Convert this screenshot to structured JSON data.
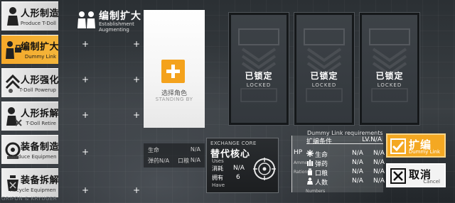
{
  "colors": {
    "accent": "#f4a822",
    "active_tab": "#f6a92a",
    "panel_light": "#ffffff",
    "locked_card": "#3a3f44"
  },
  "sidebar": {
    "items": [
      {
        "cn": "人形制造",
        "en": "Produce T-Doll",
        "icon": "doll-icon",
        "active": false
      },
      {
        "cn": "编制扩大",
        "en": "Dummy Link",
        "icon": "dummy-link-icon",
        "active": true
      },
      {
        "cn": "人形强化",
        "en": "T-Doll Powerup",
        "icon": "powerup-icon",
        "active": false
      },
      {
        "cn": "人形拆解",
        "en": "T-Doll Retire",
        "icon": "retire-icon",
        "active": false
      },
      {
        "cn": "装备制造",
        "en": "Produce Equipment",
        "icon": "equipment-produce-icon",
        "active": false
      },
      {
        "cn": "装备拆解",
        "en": "Recycle Equipment",
        "icon": "equipment-recycle-icon",
        "active": false
      }
    ],
    "footer": "GRIFON & KRYUGER"
  },
  "header": {
    "icon": "group-icon",
    "title_cn": "编制扩大",
    "title_en_1": "Establishment",
    "title_en_2": "Augmenting"
  },
  "select_slot": {
    "label_cn": "选择角色",
    "label_en": "STANDING BY",
    "icon": "plus-icon"
  },
  "locked_cards": [
    {
      "cn": "已锁定",
      "en": "LOCKED"
    },
    {
      "cn": "已锁定",
      "en": "LOCKED"
    },
    {
      "cn": "已锁定",
      "en": "LOCKED"
    }
  ],
  "stats": {
    "hp_label": "生命",
    "hp_value": "N/A",
    "ammo_label": "弹药N/A",
    "rations_label": "口粮",
    "rations_value": "N/A"
  },
  "exchange_core": {
    "title_en": "EXCHANGE CORE",
    "title_cn": "替代核心",
    "uses_en": "Uses",
    "uses_cn": "消耗",
    "uses_value": "N/A",
    "have_cn": "拥有",
    "have_value": "6",
    "have_en": "Have",
    "icon": "target-icon"
  },
  "requirements": {
    "title_en": "Dummy Link requirements",
    "header_cn": "扩编条件",
    "header_lv": "LV.N/A",
    "side_hp": "HP",
    "side_ammo": "Ammo",
    "side_rations": "Rations",
    "numbers_label": "Numbers",
    "rows": [
      {
        "icon": "hp-icon",
        "name": "生命",
        "v1": "N/A",
        "v2": "N/A"
      },
      {
        "icon": "ammo-icon",
        "name": "弹药",
        "v1": "N/A",
        "v2": "N/A"
      },
      {
        "icon": "rations-icon",
        "name": "口粮",
        "v1": "N/A",
        "v2": "N/A"
      },
      {
        "icon": "people-icon",
        "name": "人数",
        "v1": "N/A",
        "v2": "N/A"
      }
    ]
  },
  "actions": {
    "upgrade_cn": "扩编",
    "upgrade_en": "Dummy Link",
    "cancel_cn": "取消",
    "cancel_en": "Cancel"
  }
}
